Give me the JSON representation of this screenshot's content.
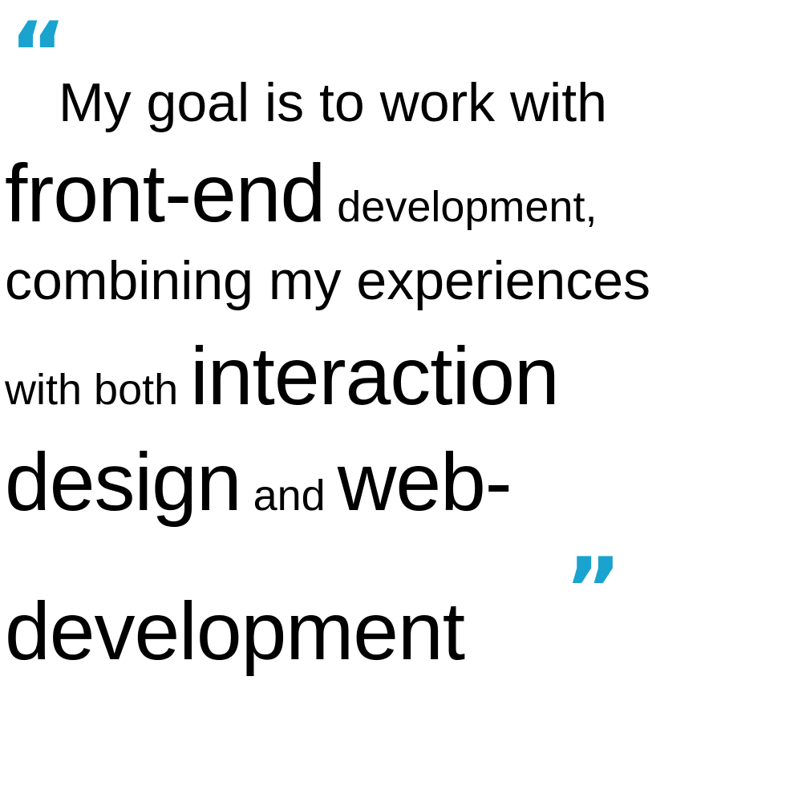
{
  "quote": {
    "open_mark": "“",
    "close_mark": "”",
    "accent_color": "#1aa3cf",
    "line1": "My goal is to work with",
    "line2_big": "front-end",
    "line2_small": " development,",
    "line3": "combining my experiences",
    "line4_small": "with both ",
    "line4_big": "interaction",
    "line5_big": "design",
    "line5_small": " and ",
    "line5_big2": "web-",
    "line6_big": "development"
  }
}
